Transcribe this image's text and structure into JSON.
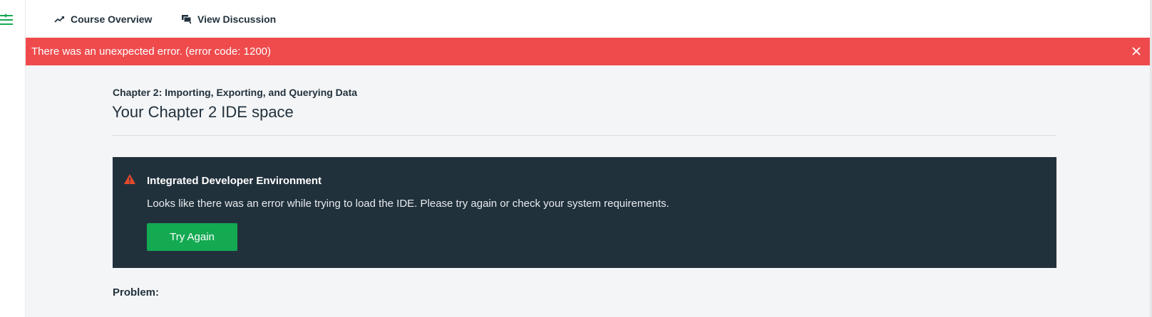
{
  "nav": {
    "course_overview": "Course Overview",
    "view_discussion": "View Discussion"
  },
  "error_banner": {
    "message": "There was an unexpected error. (error code: 1200)"
  },
  "content": {
    "chapter": "Chapter 2: Importing, Exporting, and Querying Data",
    "title": "Your Chapter 2 IDE space",
    "ide_panel": {
      "title": "Integrated Developer Environment",
      "message": "Looks like there was an error while trying to load the IDE. Please try again or check your system requirements.",
      "button_label": "Try Again"
    },
    "problem_label": "Problem:"
  },
  "colors": {
    "accent_green": "#13aa52",
    "error_red": "#ef4b4d",
    "panel_dark": "#21313c",
    "warning_icon": "#e7492c"
  },
  "icons": {
    "menu": "menu-collapse-icon",
    "course": "trending-up-icon",
    "discussion": "chat-bubbles-icon",
    "close": "close-icon",
    "warning": "warning-triangle-icon"
  }
}
